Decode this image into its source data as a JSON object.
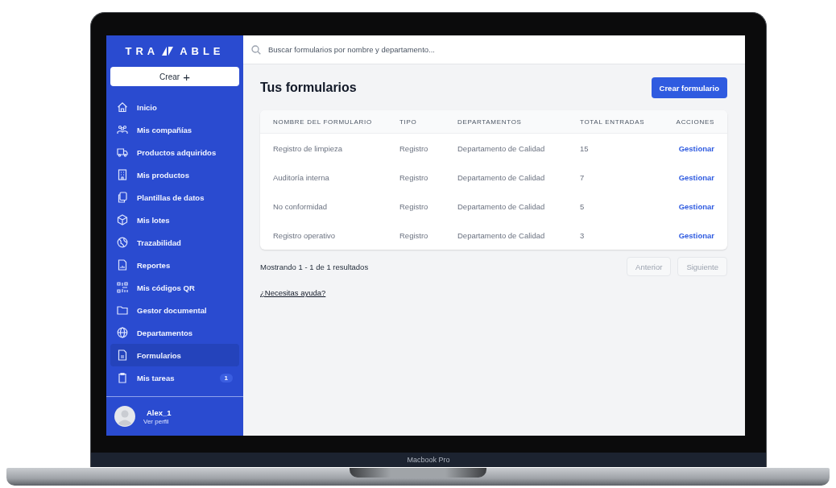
{
  "device": {
    "label": "Macbook Pro"
  },
  "sidebar": {
    "logo": {
      "left": "TRA",
      "right": "ABLE"
    },
    "create_button": "Crear",
    "create_icon": "+",
    "items": [
      {
        "label": "Inicio",
        "selected": false
      },
      {
        "label": "Mis compañías",
        "selected": false
      },
      {
        "label": "Productos adquiridos",
        "selected": false
      },
      {
        "label": "Mis productos",
        "selected": false
      },
      {
        "label": "Plantillas de datos",
        "selected": false
      },
      {
        "label": "Mis lotes",
        "selected": false
      },
      {
        "label": "Trazabilidad",
        "selected": false
      },
      {
        "label": "Reportes",
        "selected": false
      },
      {
        "label": "Mis códigos QR",
        "selected": false
      },
      {
        "label": "Gestor documental",
        "selected": false
      },
      {
        "label": "Departamentos",
        "selected": false
      },
      {
        "label": "Formularios",
        "selected": true
      },
      {
        "label": "Mis tareas",
        "selected": false,
        "badge": "1"
      }
    ],
    "user": {
      "name": "Alex_1",
      "link": "Ver perfil"
    }
  },
  "search": {
    "placeholder": "Buscar formularios por nombre y departamento..."
  },
  "page": {
    "title": "Tus formularios",
    "primary_button": "Crear formulario"
  },
  "table": {
    "columns": [
      "NOMBRE DEL FORMULARIO",
      "TIPO",
      "DEPARTAMENTOS",
      "TOTAL ENTRADAS",
      "ACCIONES"
    ],
    "rows": [
      {
        "name": "Registro de limpieza",
        "type": "Registro",
        "department": "Departamento de Calidad",
        "total": "15",
        "action": "Gestionar"
      },
      {
        "name": "Auditoría interna",
        "type": "Registro",
        "department": "Departamento de Calidad",
        "total": "7",
        "action": "Gestionar"
      },
      {
        "name": "No conformidad",
        "type": "Registro",
        "department": "Departamento de Calidad",
        "total": "5",
        "action": "Gestionar"
      },
      {
        "name": "Registro operativo",
        "type": "Registro",
        "department": "Departamento de Calidad",
        "total": "3",
        "action": "Gestionar"
      }
    ]
  },
  "pagination": {
    "summary": "Mostrando 1 - 1 de 1 resultados",
    "previous": {
      "label": "Anterior",
      "disabled": true
    },
    "next": {
      "label": "Siguiente",
      "disabled": true
    }
  },
  "help_link": "¿Necesitas ayuda?"
}
